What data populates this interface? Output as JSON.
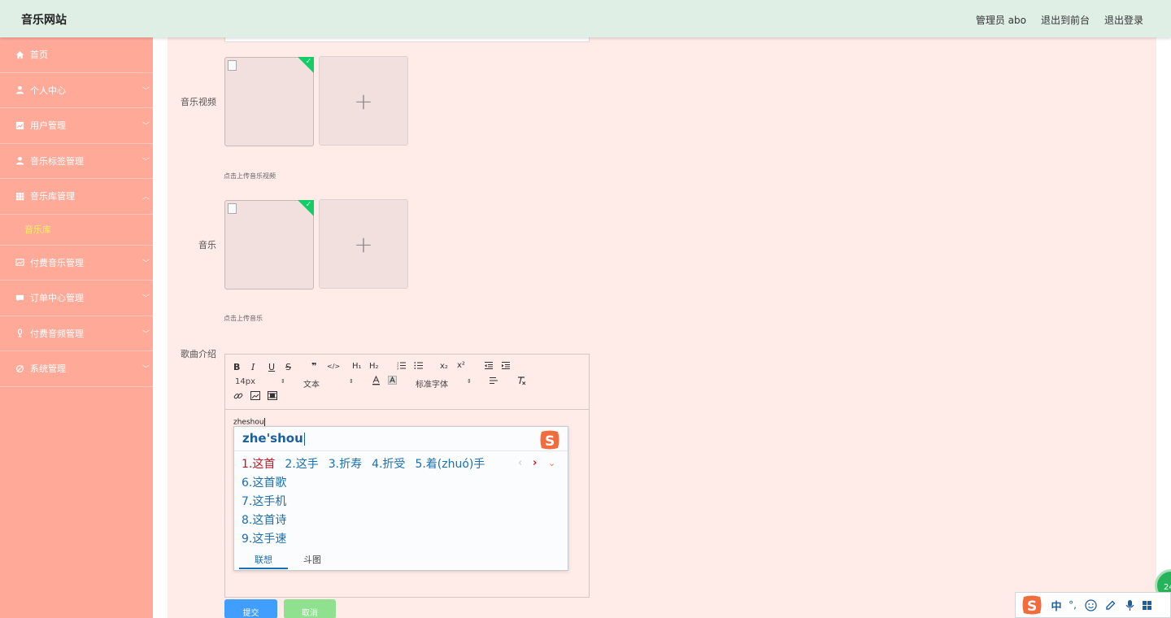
{
  "header": {
    "brand": "音乐网站",
    "admin": "管理员 abo",
    "front": "退出到前台",
    "logout": "退出登录"
  },
  "sidebar": {
    "items": [
      {
        "label": "首页",
        "icon": "home-icon"
      },
      {
        "label": "个人中心",
        "icon": "user-icon"
      },
      {
        "label": "用户管理",
        "icon": "chart-icon"
      },
      {
        "label": "音乐标签管理",
        "icon": "user-icon"
      },
      {
        "label": "音乐库管理",
        "icon": "grid-icon"
      },
      {
        "label": "付费音乐管理",
        "icon": "image-icon"
      },
      {
        "label": "订单中心管理",
        "icon": "chat-icon"
      },
      {
        "label": "付费音频管理",
        "icon": "mic-icon"
      },
      {
        "label": "系统管理",
        "icon": "settings-icon"
      }
    ],
    "sub_item": "音乐库"
  },
  "form": {
    "video_label": "音乐视频",
    "video_hint": "点击上传音乐视频",
    "music_label": "音乐",
    "music_hint": "点击上传音乐",
    "intro_label": "歌曲介绍"
  },
  "editor": {
    "font_size": "14px",
    "text_type": "文本",
    "font_family": "标准字体",
    "typed": "zheshou",
    "toolbar": {
      "bold": "B",
      "italic": "I",
      "underline": "U",
      "strike": "S",
      "quote": "❞",
      "code": "</>",
      "h1": "H₁",
      "h2": "H₂",
      "sub": "x₂",
      "sup": "x²"
    }
  },
  "ime": {
    "pinyin": "zhe'shou",
    "candidates_row": [
      "1.这首",
      "2.这手",
      "3.折寿",
      "4.折受",
      "5.着(zhuó)手"
    ],
    "candidates_list": [
      "6.这首歌",
      "7.这手机",
      "8.这首诗",
      "9.这手速"
    ],
    "tabs": [
      "联想",
      "斗图"
    ],
    "bar_mode": "中"
  },
  "buttons": {
    "submit": "提交",
    "cancel": "取消"
  },
  "floating": {
    "badge": "24"
  },
  "colors": {
    "header_bg": "#e0efe6",
    "sidebar_bg": "#ffaa99",
    "main_bg": "#ffebe7",
    "active_sub": "#fff25c",
    "check": "#13ce66",
    "primary": "#409eff"
  }
}
